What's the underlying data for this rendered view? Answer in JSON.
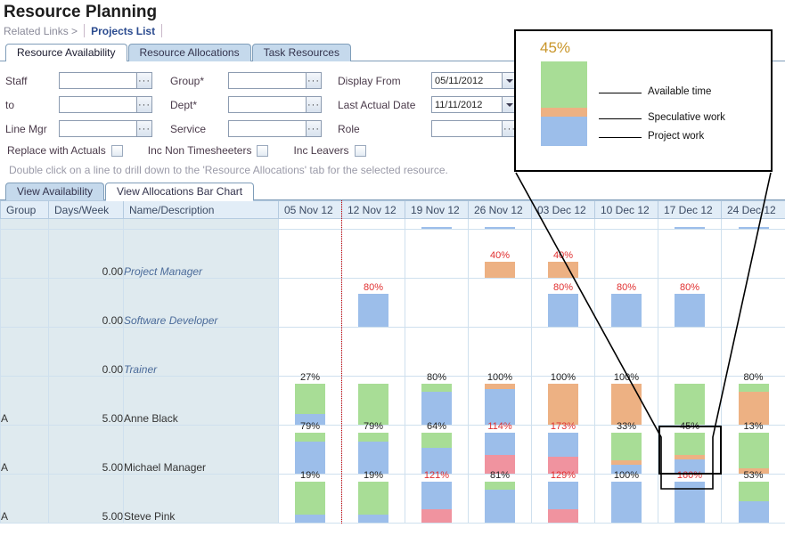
{
  "header": {
    "title": "Resource Planning",
    "related_links_text": "Related Links >",
    "projects_list_link": "Projects List"
  },
  "tabs": [
    {
      "label": "Resource Availability",
      "active": true
    },
    {
      "label": "Resource Allocations",
      "active": false
    },
    {
      "label": "Task Resources",
      "active": false
    }
  ],
  "filters": {
    "staff_label": "Staff",
    "staff_value": "",
    "to_label": "to",
    "to_value": "",
    "line_mgr_label": "Line Mgr",
    "line_mgr_value": "",
    "group_label": "Group*",
    "group_value": "",
    "dept_label": "Dept*",
    "dept_value": "",
    "service_label": "Service",
    "service_value": "",
    "display_from_label": "Display From",
    "display_from_value": "05/11/2012",
    "last_actual_label": "Last Actual Date",
    "last_actual_value": "11/11/2012",
    "role_label": "Role",
    "role_value": "",
    "ellipsis_glyph": "···",
    "checkboxes": [
      {
        "label": "Replace with Actuals",
        "checked": false
      },
      {
        "label": "Inc Non Timesheeters",
        "checked": false
      },
      {
        "label": "Inc Leavers",
        "checked": false
      }
    ],
    "hint": "Double click on a line to drill down to the 'Resource Allocations' tab for the selected resource."
  },
  "subtabs": [
    {
      "label": "View Availability",
      "selected": true
    },
    {
      "label": "View Allocations Bar Chart",
      "selected": false
    }
  ],
  "grid": {
    "columns": [
      "Group",
      "Days/Week",
      "Name/Description"
    ],
    "date_columns": [
      "05 Nov 12",
      "12 Nov 12",
      "19 Nov 12",
      "26 Nov 12",
      "03 Dec 12",
      "10 Dec 12",
      "17 Dec 12",
      "24 Dec 12"
    ],
    "rows": [
      {
        "group": "",
        "days": "",
        "name": "",
        "italic": true,
        "partial_top": true,
        "cells": [
          {
            "label": "",
            "avail": 0,
            "spec": 0,
            "proj": 0,
            "over": 0
          },
          {
            "label": "",
            "avail": 0,
            "spec": 0,
            "proj": 0,
            "over": 0
          },
          {
            "label": "",
            "avail": 0,
            "spec": 0,
            "proj": 20,
            "over": 0
          },
          {
            "label": "",
            "avail": 0,
            "spec": 0,
            "proj": 20,
            "over": 0
          },
          {
            "label": "",
            "avail": 0,
            "spec": 0,
            "proj": 0,
            "over": 0
          },
          {
            "label": "",
            "avail": 0,
            "spec": 0,
            "proj": 0,
            "over": 0
          },
          {
            "label": "",
            "avail": 0,
            "spec": 0,
            "proj": 20,
            "over": 0
          },
          {
            "label": "",
            "avail": 0,
            "spec": 0,
            "proj": 20,
            "over": 0
          }
        ]
      },
      {
        "group": "",
        "days": "0.00",
        "name": "Project Manager",
        "italic": true,
        "cells": [
          {
            "label": "",
            "avail": 0,
            "spec": 0,
            "proj": 0,
            "over": 0
          },
          {
            "label": "",
            "avail": 0,
            "spec": 0,
            "proj": 0,
            "over": 0
          },
          {
            "label": "",
            "avail": 0,
            "spec": 0,
            "proj": 0,
            "over": 0
          },
          {
            "label": "40%",
            "label_color": "red",
            "avail": 0,
            "spec": 40,
            "proj": 0,
            "over": 0
          },
          {
            "label": "40%",
            "label_color": "red",
            "avail": 0,
            "spec": 40,
            "proj": 0,
            "over": 0
          },
          {
            "label": "",
            "avail": 0,
            "spec": 0,
            "proj": 0,
            "over": 0
          },
          {
            "label": "",
            "avail": 0,
            "spec": 0,
            "proj": 0,
            "over": 0
          },
          {
            "label": "",
            "avail": 0,
            "spec": 0,
            "proj": 0,
            "over": 0
          }
        ]
      },
      {
        "group": "",
        "days": "0.00",
        "name": "Software Developer",
        "italic": true,
        "cells": [
          {
            "label": "",
            "avail": 0,
            "spec": 0,
            "proj": 0,
            "over": 0
          },
          {
            "label": "80%",
            "label_color": "red",
            "avail": 0,
            "spec": 0,
            "proj": 80,
            "over": 0
          },
          {
            "label": "",
            "avail": 0,
            "spec": 0,
            "proj": 0,
            "over": 0
          },
          {
            "label": "",
            "avail": 0,
            "spec": 0,
            "proj": 0,
            "over": 0
          },
          {
            "label": "80%",
            "label_color": "red",
            "avail": 0,
            "spec": 0,
            "proj": 80,
            "over": 0
          },
          {
            "label": "80%",
            "label_color": "red",
            "avail": 0,
            "spec": 0,
            "proj": 80,
            "over": 0
          },
          {
            "label": "80%",
            "label_color": "red",
            "avail": 0,
            "spec": 0,
            "proj": 80,
            "over": 0
          },
          {
            "label": "",
            "avail": 0,
            "spec": 0,
            "proj": 0,
            "over": 0
          }
        ]
      },
      {
        "group": "",
        "days": "0.00",
        "name": "Trainer",
        "italic": true,
        "cells": [
          {
            "label": "",
            "avail": 0,
            "spec": 0,
            "proj": 0,
            "over": 0
          },
          {
            "label": "",
            "avail": 0,
            "spec": 0,
            "proj": 0,
            "over": 0
          },
          {
            "label": "",
            "avail": 0,
            "spec": 0,
            "proj": 0,
            "over": 0
          },
          {
            "label": "",
            "avail": 0,
            "spec": 0,
            "proj": 0,
            "over": 0
          },
          {
            "label": "",
            "avail": 0,
            "spec": 0,
            "proj": 0,
            "over": 0
          },
          {
            "label": "",
            "avail": 0,
            "spec": 0,
            "proj": 0,
            "over": 0
          },
          {
            "label": "",
            "avail": 0,
            "spec": 0,
            "proj": 0,
            "over": 0
          },
          {
            "label": "",
            "avail": 0,
            "spec": 0,
            "proj": 0,
            "over": 0
          }
        ]
      },
      {
        "group": "A",
        "days": "5.00",
        "name": "Anne Black",
        "italic": false,
        "cells": [
          {
            "label": "27%",
            "label_color": "black",
            "avail": 73,
            "spec": 0,
            "proj": 27,
            "over": 0
          },
          {
            "label": "",
            "avail": 100,
            "spec": 0,
            "proj": 0,
            "over": 0
          },
          {
            "label": "80%",
            "label_color": "black",
            "avail": 20,
            "spec": 0,
            "proj": 80,
            "over": 0
          },
          {
            "label": "100%",
            "label_color": "black",
            "avail": 0,
            "spec": 12,
            "proj": 88,
            "over": 0
          },
          {
            "label": "100%",
            "label_color": "black",
            "avail": 0,
            "spec": 100,
            "proj": 0,
            "over": 0
          },
          {
            "label": "100%",
            "label_color": "black",
            "avail": 0,
            "spec": 100,
            "proj": 0,
            "over": 0
          },
          {
            "label": "",
            "avail": 100,
            "spec": 0,
            "proj": 0,
            "over": 0
          },
          {
            "label": "80%",
            "label_color": "black",
            "avail": 20,
            "spec": 80,
            "proj": 0,
            "over": 0
          }
        ]
      },
      {
        "group": "A",
        "days": "5.00",
        "name": "Michael Manager",
        "italic": false,
        "cells": [
          {
            "label": "79%",
            "label_color": "black",
            "avail": 21,
            "spec": 0,
            "proj": 79,
            "over": 0
          },
          {
            "label": "79%",
            "label_color": "black",
            "avail": 21,
            "spec": 0,
            "proj": 79,
            "over": 0
          },
          {
            "label": "64%",
            "label_color": "black",
            "avail": 36,
            "spec": 0,
            "proj": 64,
            "over": 0
          },
          {
            "label": "114%",
            "label_color": "red",
            "avail": 0,
            "spec": 0,
            "proj": 55,
            "over": 45
          },
          {
            "label": "173%",
            "label_color": "red",
            "avail": 0,
            "spec": 0,
            "proj": 58,
            "over": 42
          },
          {
            "label": "33%",
            "label_color": "black",
            "avail": 67,
            "spec": 12,
            "proj": 21,
            "over": 0
          },
          {
            "label": "45%",
            "label_color": "black",
            "avail": 55,
            "spec": 10,
            "proj": 35,
            "over": 0,
            "highlight": true
          },
          {
            "label": "13%",
            "label_color": "black",
            "avail": 87,
            "spec": 13,
            "proj": 0,
            "over": 0
          }
        ]
      },
      {
        "group": "A",
        "days": "5.00",
        "name": "Steve Pink",
        "italic": false,
        "cells": [
          {
            "label": "19%",
            "label_color": "black",
            "avail": 81,
            "spec": 0,
            "proj": 19,
            "over": 0
          },
          {
            "label": "19%",
            "label_color": "black",
            "avail": 81,
            "spec": 0,
            "proj": 19,
            "over": 0
          },
          {
            "label": "121%",
            "label_color": "red",
            "avail": 0,
            "spec": 0,
            "proj": 67,
            "over": 33
          },
          {
            "label": "81%",
            "label_color": "black",
            "avail": 19,
            "spec": 0,
            "proj": 81,
            "over": 0
          },
          {
            "label": "129%",
            "label_color": "red",
            "avail": 0,
            "spec": 0,
            "proj": 68,
            "over": 32
          },
          {
            "label": "100%",
            "label_color": "black",
            "avail": 0,
            "spec": 0,
            "proj": 100,
            "over": 0
          },
          {
            "label": "160%",
            "label_color": "red",
            "avail": 0,
            "spec": 0,
            "proj": 100,
            "over": 0
          },
          {
            "label": "53%",
            "label_color": "black",
            "avail": 47,
            "spec": 0,
            "proj": 53,
            "over": 0
          }
        ]
      }
    ]
  },
  "callout": {
    "percent": "45%",
    "legend": [
      {
        "label": "Available time",
        "color": "#a8dd96"
      },
      {
        "label": "Speculative work",
        "color": "#edb183"
      },
      {
        "label": "Project work",
        "color": "#9cbeea"
      }
    ],
    "bar": {
      "avail": 55,
      "spec": 10,
      "proj": 35
    }
  },
  "colors": {
    "available": "#a8dd96",
    "speculative": "#edb183",
    "project": "#9cbeea",
    "overallocated": "#f0939f",
    "tab_inactive": "#c5d9ec",
    "header_bg": "#e2edf7",
    "label_bg": "#dfeaef",
    "link": "#2b4b8f",
    "today_line": "#cc0000"
  }
}
